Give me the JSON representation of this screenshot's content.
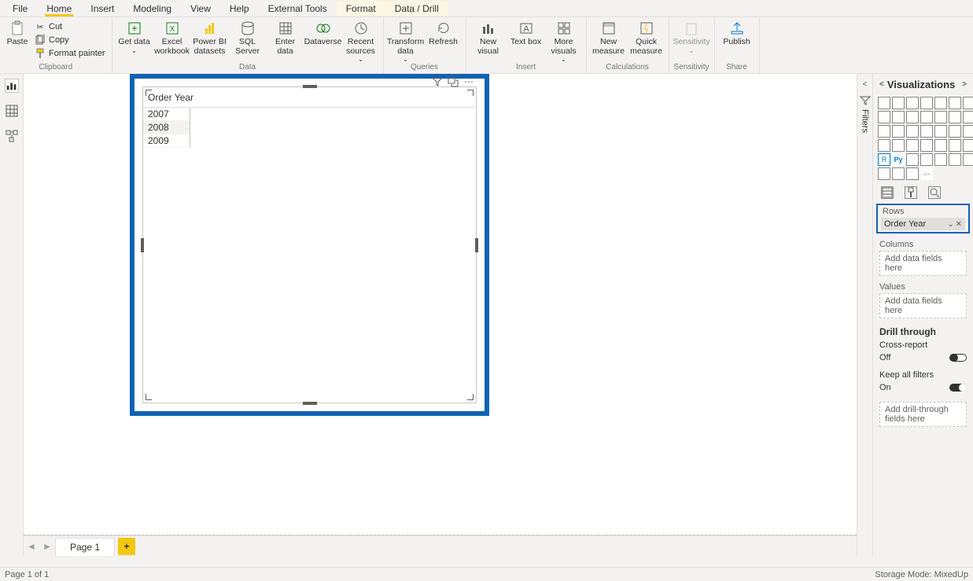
{
  "tabs": [
    "File",
    "Home",
    "Insert",
    "Modeling",
    "View",
    "Help",
    "External Tools",
    "Format",
    "Data / Drill"
  ],
  "activeTab": "Home",
  "highlightTabs": [
    "Format",
    "Data / Drill"
  ],
  "ribbon": {
    "clipboard": {
      "label": "Clipboard",
      "paste": "Paste",
      "cut": "Cut",
      "copy": "Copy",
      "format_painter": "Format painter"
    },
    "data": {
      "label": "Data",
      "get_data": "Get data",
      "excel": "Excel workbook",
      "pbids": "Power BI datasets",
      "sql": "SQL Server",
      "enter": "Enter data",
      "dataverse": "Dataverse",
      "recent": "Recent sources"
    },
    "queries": {
      "label": "Queries",
      "transform": "Transform data",
      "refresh": "Refresh"
    },
    "insert": {
      "label": "Insert",
      "new_visual": "New visual",
      "text_box": "Text box",
      "more_visuals": "More visuals"
    },
    "calculations": {
      "label": "Calculations",
      "new_measure": "New measure",
      "quick_measure": "Quick measure"
    },
    "sensitivity": {
      "label": "Sensitivity",
      "btn": "Sensitivity"
    },
    "share": {
      "label": "Share",
      "publish": "Publish"
    }
  },
  "leftrail": [
    "report-view",
    "data-view",
    "model-view"
  ],
  "filtersLabel": "Filters",
  "visual": {
    "header": "Order Year",
    "rows": [
      "2007",
      "2008",
      "2009"
    ]
  },
  "pageTab": "Page 1",
  "status": {
    "left": "Page 1 of 1",
    "right": "Storage Mode: MixedUp"
  },
  "vizpane": {
    "title": "Visualizations",
    "rows_label": "Rows",
    "rows_field": "Order Year",
    "columns_label": "Columns",
    "add_placeholder": "Add data fields here",
    "values_label": "Values",
    "drill_title": "Drill through",
    "cross_report": "Cross-report",
    "off": "Off",
    "keep_filters": "Keep all filters",
    "on": "On",
    "drill_placeholder": "Add drill-through fields here"
  }
}
